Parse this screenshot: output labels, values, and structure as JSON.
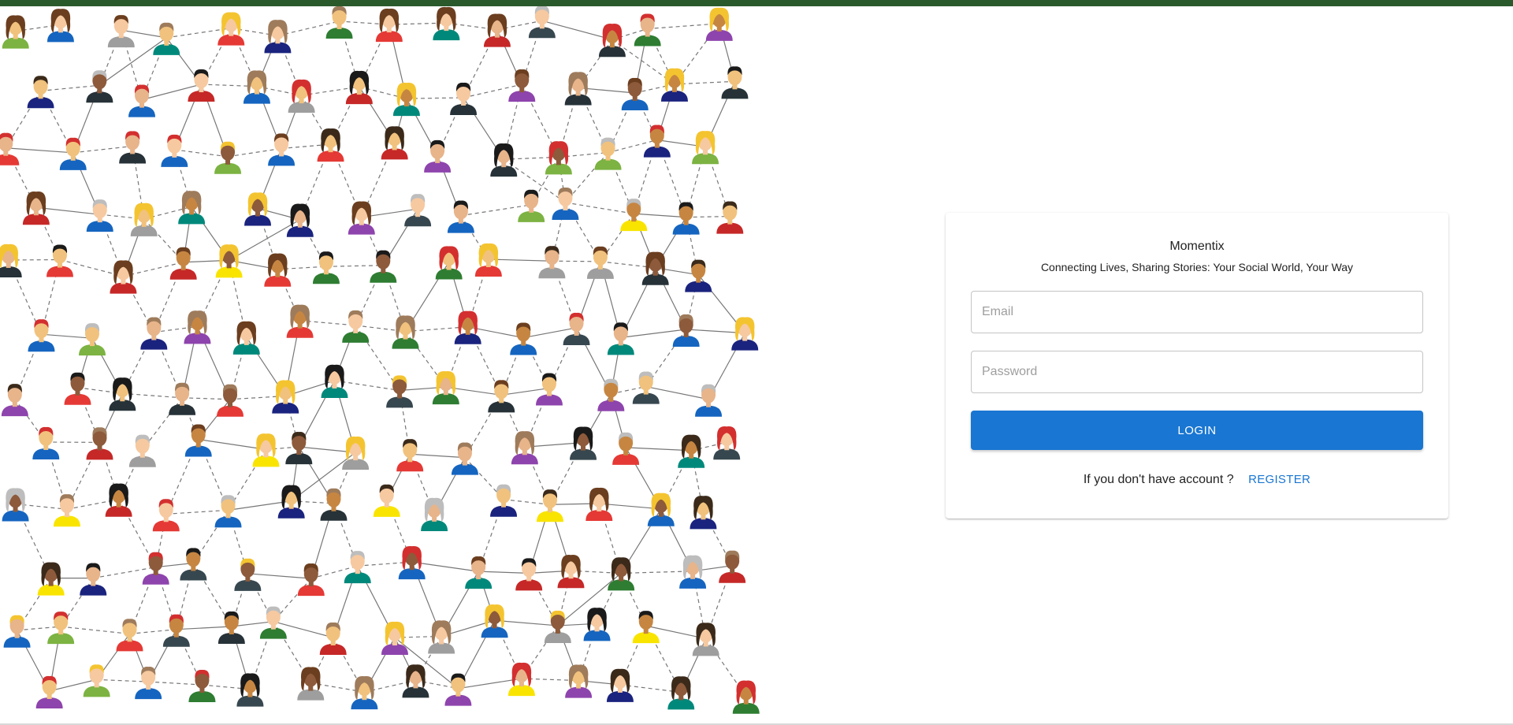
{
  "app": {
    "brand": "Momentix",
    "tagline": "Connecting Lives, Sharing Stories: Your Social World, Your Way"
  },
  "colors": {
    "top_bar": "#2a5a2c",
    "primary": "#1976d2"
  },
  "login_form": {
    "email_placeholder": "Email",
    "email_value": "",
    "password_placeholder": "Password",
    "password_value": "",
    "login_label": "LOGIN",
    "register_prompt": "If you don't have account ?",
    "register_label": "REGISTER"
  },
  "illustration": {
    "icon": "social-network-people-illustration"
  }
}
